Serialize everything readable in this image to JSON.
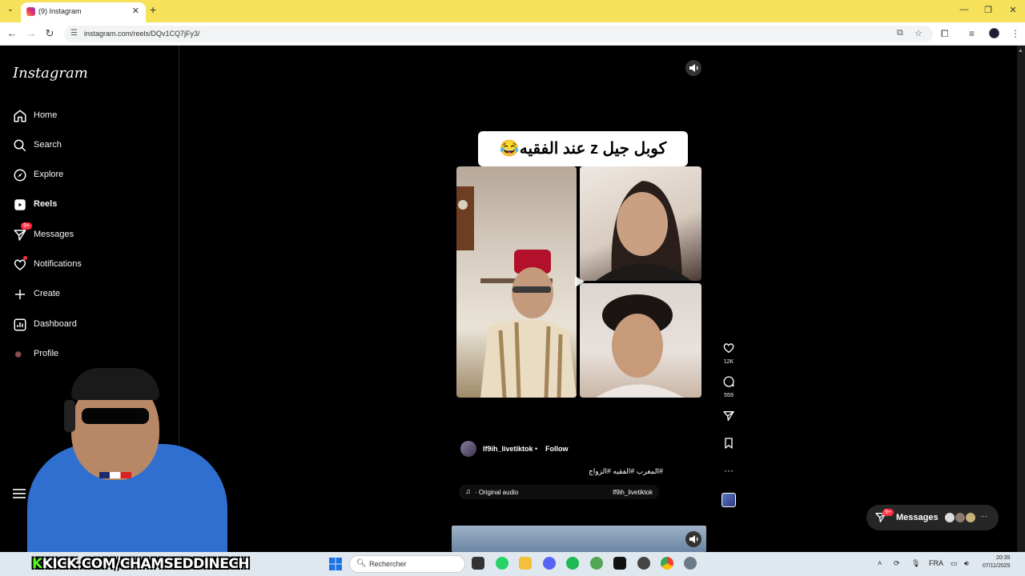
{
  "browser": {
    "tab_title": "(9) Instagram",
    "tab_close": "✕",
    "new_tab": "+",
    "url": "instagram.com/reels/DQv1CQ7jFy3/",
    "window_controls": [
      "—",
      "❐",
      "✕"
    ]
  },
  "sidebar": {
    "logo": "Instagram",
    "items": [
      {
        "label": "Home",
        "icon": "home-icon"
      },
      {
        "label": "Search",
        "icon": "search-icon"
      },
      {
        "label": "Explore",
        "icon": "compass-icon"
      },
      {
        "label": "Reels",
        "icon": "reels-icon"
      },
      {
        "label": "Messages",
        "icon": "send-icon",
        "badge": "9+"
      },
      {
        "label": "Notifications",
        "icon": "heart-icon"
      },
      {
        "label": "Create",
        "icon": "plus-icon"
      },
      {
        "label": "Dashboard",
        "icon": "chart-icon"
      },
      {
        "label": "Profile",
        "icon": "avatar-icon"
      }
    ]
  },
  "reel": {
    "caption_overlay": "كوبل جيل z عند الفقيه😂",
    "likes": "12K",
    "comments": "559",
    "author": "lf9ih_livetiktok",
    "separator": "•",
    "follow": "Follow",
    "hashtags": "#المغرب #الفقيه #الزواج",
    "audio_label": "· Original audio",
    "audio_author": "lf9ih_livetiktok",
    "more": "···"
  },
  "messages_pill": {
    "label": "Messages",
    "badge": "9+",
    "more": "···"
  },
  "overlay": {
    "kick_k": "K",
    "kick_text": "KICK.COM/CHAMSEDDINECH"
  },
  "taskbar": {
    "search_placeholder": "Rechercher",
    "lang": "FRA",
    "time": "20:35",
    "date": "07/11/2025"
  },
  "colors": {
    "tab_bar": "#f5e25a",
    "badge_red": "#ff3040",
    "kick_green": "#53fc18"
  }
}
